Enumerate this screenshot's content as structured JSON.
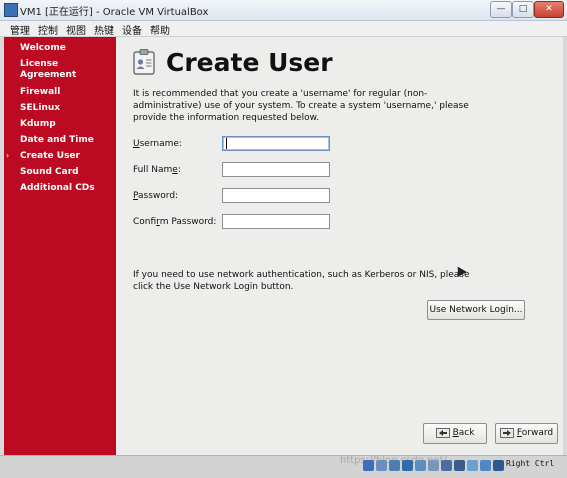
{
  "window": {
    "title": "VM1 [正在运行] - Oracle VM VirtualBox",
    "min_label": "—",
    "max_label": "□",
    "close_label": "✕"
  },
  "menu": [
    "管理",
    "控制",
    "视图",
    "热键",
    "设备",
    "帮助"
  ],
  "sidebar": {
    "items": [
      {
        "label": "Welcome"
      },
      {
        "label": "License Agreement"
      },
      {
        "label": "Firewall"
      },
      {
        "label": "SELinux"
      },
      {
        "label": "Kdump"
      },
      {
        "label": "Date and Time"
      },
      {
        "label": "Create User",
        "active": true
      },
      {
        "label": "Sound Card"
      },
      {
        "label": "Additional CDs"
      }
    ],
    "active_marker": "›"
  },
  "main": {
    "title": "Create User",
    "intro": "It is recommended that you create a 'username' for regular (non-administrative) use of your system. To create a system 'username,' please provide the information requested below.",
    "fields": [
      {
        "label_pre": "",
        "label_ul": "U",
        "label_post": "sername:",
        "value": ""
      },
      {
        "label_pre": "Full Nam",
        "label_ul": "e",
        "label_post": ":",
        "value": ""
      },
      {
        "label_pre": "",
        "label_ul": "P",
        "label_post": "assword:",
        "value": ""
      },
      {
        "label_pre": "Confi",
        "label_ul": "r",
        "label_post": "m Password:",
        "value": ""
      }
    ],
    "network_text": "If you need to use network authentication, such as Kerberos or NIS, please click the Use Network Login button.",
    "network_button": "Use Network Login..."
  },
  "nav": {
    "back_ul": "B",
    "back_rest": "ack",
    "forward_ul": "F",
    "forward_rest": "orward"
  },
  "status": {
    "host_key": "Right Ctrl",
    "watermark": "https://blog.csdn.net/..."
  },
  "colors": {
    "sidebar": "#bb0a21",
    "background": "#ededeb"
  }
}
